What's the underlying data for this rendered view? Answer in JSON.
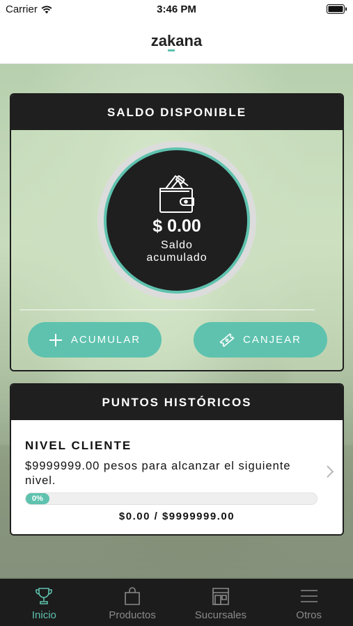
{
  "status_bar": {
    "carrier": "Carrier",
    "time": "3:46 PM"
  },
  "header": {
    "logo_text_1": "za",
    "logo_accent": "k",
    "logo_text_2": "ana"
  },
  "saldo": {
    "title": "SALDO DISPONIBLE",
    "amount": "$ 0.00",
    "subtitle": "Saldo acumulado",
    "wallet_icon": "wallet-icon",
    "buttons": [
      {
        "label": "ACUMULAR",
        "icon": "plus-icon"
      },
      {
        "label": "CANJEAR",
        "icon": "ticket-icon"
      }
    ]
  },
  "puntos": {
    "title": "PUNTOS HISTÓRICOS",
    "nivel_title": "NIVEL CLIENTE",
    "nivel_desc": "$9999999.00 pesos para alcanzar el siguiente nivel.",
    "progress_percent": 0,
    "progress_label": "0%",
    "progress_caption": "$0.00 / $9999999.00"
  },
  "tabs": [
    {
      "label": "Inicio",
      "icon": "trophy-icon",
      "active": true
    },
    {
      "label": "Productos",
      "icon": "shopping-bag-icon",
      "active": false
    },
    {
      "label": "Sucursales",
      "icon": "store-icon",
      "active": false
    },
    {
      "label": "Otros",
      "icon": "menu-icon",
      "active": false
    }
  ],
  "colors": {
    "accent": "#5ec2ae",
    "dark": "#1f1f1f",
    "inactive": "#8a8a8a"
  }
}
